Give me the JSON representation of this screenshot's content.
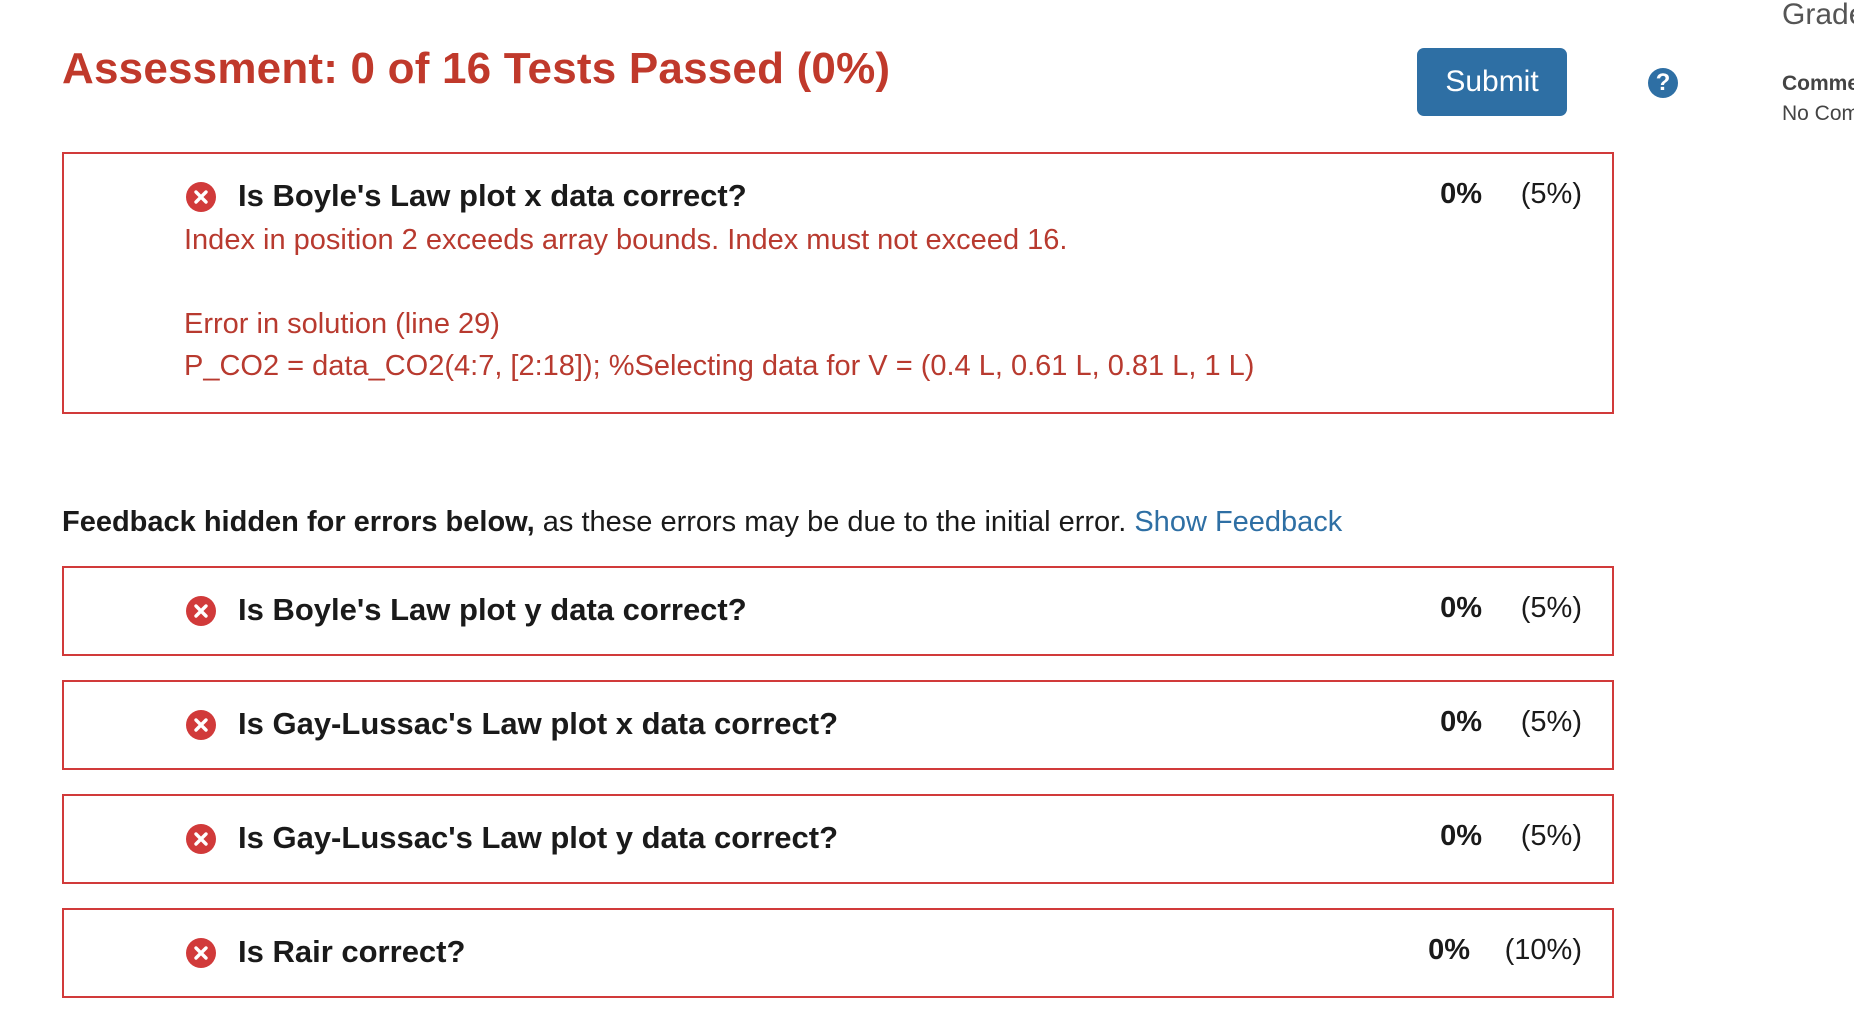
{
  "header": {
    "title": "Assessment: 0 of 16 Tests Passed (0%)",
    "submit_label": "Submit",
    "help_glyph": "?"
  },
  "tests": [
    {
      "name": "Is Boyle's Law plot x data correct?",
      "score": "0%",
      "weight": "(5%)",
      "errors": [
        "Index in position 2 exceeds array bounds. Index must not exceed 16.",
        "Error in solution (line 29)",
        "P_CO2 = data_CO2(4:7, [2:18]); %Selecting data for V = (0.4 L, 0.61 L, 0.81 L, 1 L)"
      ]
    },
    {
      "name": "Is Boyle's Law plot y data correct?",
      "score": "0%",
      "weight": "(5%)"
    },
    {
      "name": "Is Gay-Lussac's Law plot x data correct?",
      "score": "0%",
      "weight": "(5%)"
    },
    {
      "name": "Is Gay-Lussac's Law plot y data correct?",
      "score": "0%",
      "weight": "(5%)"
    },
    {
      "name": "Is Rair correct?",
      "score": "0%",
      "weight": "(10%)"
    }
  ],
  "feedback": {
    "bold_text": "Feedback hidden for errors below,",
    "text": " as these errors may be due to the initial error. ",
    "link_label": "Show Feedback"
  },
  "sidebar": {
    "grade_label": "Grade",
    "comments_label": "Comments",
    "comments_value": "No Comments"
  },
  "colors": {
    "error_red": "#d13a3a",
    "title_red": "#c0392b",
    "accent_blue": "#2e6fa4"
  },
  "icons": {
    "fail": "x-circle-icon",
    "help": "question-circle-icon"
  }
}
